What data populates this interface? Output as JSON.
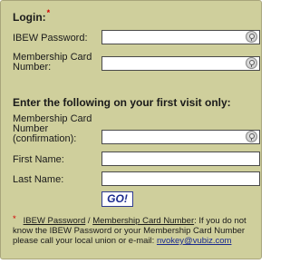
{
  "login": {
    "heading": "Login:",
    "required_mark": "*",
    "password_label": "IBEW Password:",
    "card_label": "Membership Card Number:",
    "password_value": "",
    "card_value": ""
  },
  "first_visit": {
    "heading": "Enter the following on your first visit only:",
    "card_confirm_label": "Membership Card Number (confirmation):",
    "first_name_label": "First Name:",
    "last_name_label": "Last Name:",
    "card_confirm_value": "",
    "first_name_value": "",
    "last_name_value": ""
  },
  "go_button": "GO!",
  "note": {
    "star": "*",
    "link_password": "IBEW Password",
    "separator": " / ",
    "link_card": "Membership Card Number",
    "text": ": If you do not know the IBEW Password or your Membership Card Number please call your local union or e-mail: ",
    "email": "nvokey@vubiz.com"
  },
  "icons": {
    "field_key": "key-icon"
  },
  "colors": {
    "panel_bg": "#cfcf9c",
    "required_red": "#d40000",
    "button_text": "#1a2a8f"
  }
}
